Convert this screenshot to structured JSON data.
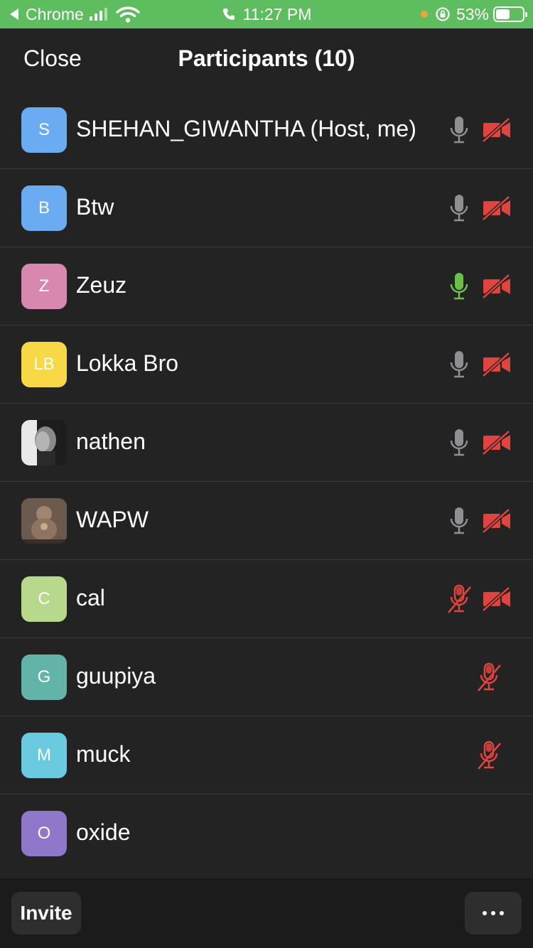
{
  "status_bar": {
    "back_app": "Chrome",
    "time": "11:27 PM",
    "battery": "53%",
    "battery_level": 0.53
  },
  "header": {
    "close_label": "Close",
    "title": "Participants (10)"
  },
  "colors": {
    "status_green": "#5ebd5e",
    "mic_gray": "#8e8e93",
    "mic_active": "#6cc04a",
    "muted_red": "#e0443e"
  },
  "participants": [
    {
      "initials": "S",
      "name": "SHEHAN_GIWANTHA (Host, me)",
      "avatar_color": "#6aabf1",
      "mic": "on",
      "video": "off"
    },
    {
      "initials": "B",
      "name": "Btw",
      "avatar_color": "#6aabf1",
      "mic": "on",
      "video": "off"
    },
    {
      "initials": "Z",
      "name": "Zeuz",
      "avatar_color": "#d888ae",
      "mic": "speaking",
      "video": "off"
    },
    {
      "initials": "LB",
      "name": "Lokka Bro",
      "avatar_color": "#f9d847",
      "mic": "on",
      "video": "off"
    },
    {
      "initials": "",
      "name": "nathen",
      "avatar_color": "#1c1c1c",
      "avatar_photo": true,
      "mic": "on",
      "video": "off"
    },
    {
      "initials": "",
      "name": "WAPW",
      "avatar_color": "#5a4a40",
      "avatar_photo": true,
      "mic": "on",
      "video": "off"
    },
    {
      "initials": "C",
      "name": "cal",
      "avatar_color": "#b8d88c",
      "mic": "muted",
      "video": "off"
    },
    {
      "initials": "G",
      "name": "guupiya",
      "avatar_color": "#62b3a8",
      "mic": "muted",
      "video": "none"
    },
    {
      "initials": "M",
      "name": "muck",
      "avatar_color": "#6acbe0",
      "mic": "muted",
      "video": "none"
    },
    {
      "initials": "O",
      "name": "oxide",
      "avatar_color": "#8f78c9",
      "mic": "none",
      "video": "none"
    }
  ],
  "footer": {
    "invite_label": "Invite"
  }
}
